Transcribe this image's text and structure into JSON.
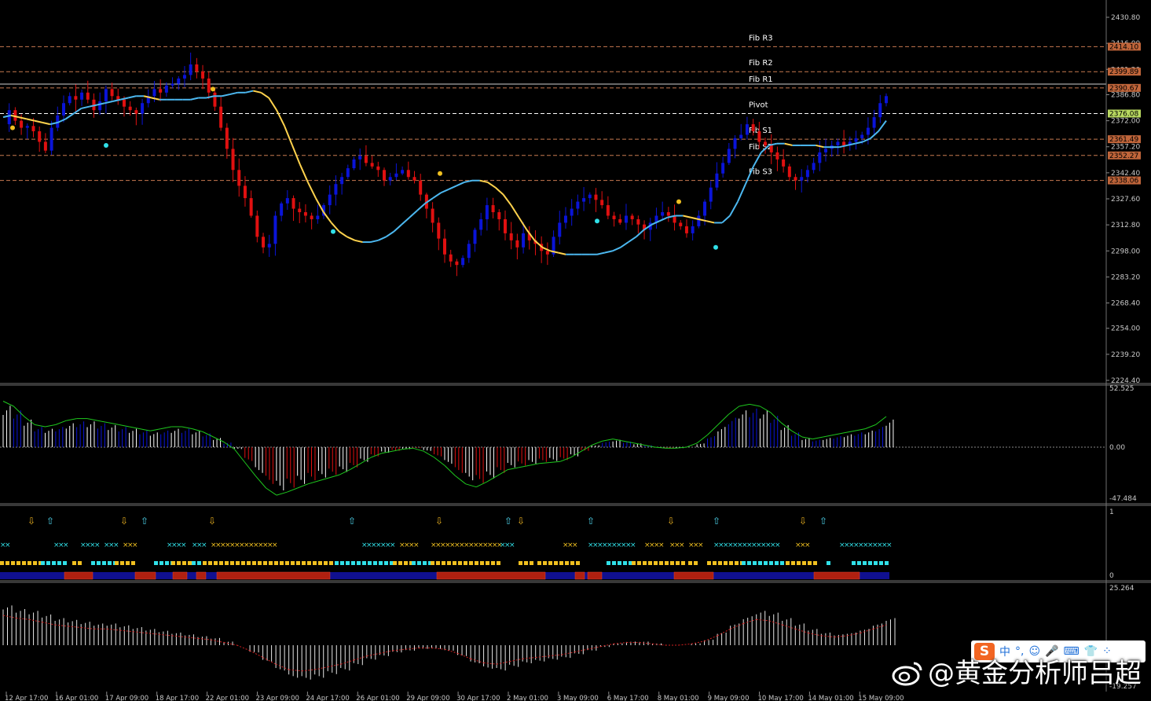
{
  "colors": {
    "bull": "#0a14d8",
    "bear": "#e01010",
    "ma_up": "#4cb8f0",
    "ma_down": "#ffd34d",
    "grid": "#555555",
    "fib_line": "#c87a50",
    "pivot_line": "#ffffff",
    "fib_label_bg": "#c0653a",
    "pivot_label_bg": "#b8d860",
    "osc_line": "#1ec81e",
    "osc2_line": "#d02020",
    "arrow_up": "#4cd0e8",
    "arrow_down": "#e8b020",
    "marker_cyan": "#30e0e8",
    "marker_yellow": "#f0c020",
    "band_blue": "#101090",
    "band_red": "#b02010"
  },
  "price_axis": {
    "ticks": [
      "2430.80",
      "2416.00",
      "2401.20",
      "2386.80",
      "2372.00",
      "2357.20",
      "2342.40",
      "2327.60",
      "2312.80",
      "2298.00",
      "2283.20",
      "2268.40",
      "2254.00",
      "2239.20",
      "2224.40"
    ],
    "min": 2224.4,
    "max": 2430.8
  },
  "levels": [
    {
      "name": "Fib R3",
      "value": 2414.1,
      "label": "2414.10",
      "kind": "fib"
    },
    {
      "name": "Fib R2",
      "value": 2399.89,
      "label": "2399.89",
      "kind": "fib"
    },
    {
      "name": "Fib R1",
      "value": 2390.67,
      "label": "2390.67",
      "kind": "fib"
    },
    {
      "name": "Pivot",
      "value": 2376.08,
      "label": "2376.08",
      "kind": "pivot"
    },
    {
      "name": "Fib S1",
      "value": 2361.49,
      "label": "2361.49",
      "kind": "fib"
    },
    {
      "name": "Fib S2",
      "value": 2352.27,
      "label": "2352.27",
      "kind": "fib"
    },
    {
      "name": "Fib S3",
      "value": 2338.06,
      "label": "2338.06",
      "kind": "fib"
    }
  ],
  "price_series": [
    2370,
    2378,
    2372,
    2368,
    2369,
    2366,
    2360,
    2355,
    2368,
    2375,
    2382,
    2386,
    2384,
    2388,
    2384,
    2378,
    2383,
    2390,
    2386,
    2384,
    2380,
    2378,
    2376,
    2382,
    2386,
    2390,
    2388,
    2392,
    2393,
    2396,
    2398,
    2404,
    2400,
    2396,
    2388,
    2380,
    2368,
    2356,
    2344,
    2335,
    2328,
    2318,
    2306,
    2300,
    2302,
    2318,
    2325,
    2328,
    2322,
    2320,
    2318,
    2316,
    2318,
    2324,
    2330,
    2336,
    2340,
    2345,
    2350,
    2352,
    2348,
    2346,
    2344,
    2338,
    2340,
    2342,
    2344,
    2340,
    2338,
    2330,
    2322,
    2314,
    2305,
    2296,
    2292,
    2290,
    2294,
    2302,
    2310,
    2316,
    2324,
    2320,
    2316,
    2308,
    2304,
    2300,
    2308,
    2304,
    2302,
    2298,
    2296,
    2306,
    2314,
    2318,
    2322,
    2326,
    2328,
    2330,
    2327,
    2324,
    2318,
    2316,
    2314,
    2318,
    2316,
    2313,
    2310,
    2314,
    2318,
    2320,
    2318,
    2314,
    2312,
    2308,
    2312,
    2318,
    2326,
    2334,
    2342,
    2348,
    2356,
    2362,
    2364,
    2370,
    2366,
    2360,
    2358,
    2354,
    2350,
    2346,
    2340,
    2338,
    2340,
    2344,
    2348,
    2354,
    2356,
    2358,
    2360,
    2358,
    2360,
    2362,
    2364,
    2368,
    2374,
    2382,
    2386
  ],
  "ma_series": [
    2374,
    2375,
    2374,
    2373,
    2372,
    2371,
    2370,
    2371,
    2373,
    2376,
    2379,
    2380,
    2381,
    2382,
    2383,
    2384,
    2385,
    2386,
    2386,
    2385,
    2384,
    2384,
    2384,
    2384,
    2384,
    2385,
    2385,
    2386,
    2386,
    2387,
    2388,
    2388,
    2389,
    2388,
    2385,
    2378,
    2369,
    2358,
    2347,
    2337,
    2328,
    2320,
    2314,
    2309,
    2306,
    2304,
    2303,
    2303,
    2304,
    2306,
    2309,
    2313,
    2317,
    2321,
    2325,
    2328,
    2331,
    2333,
    2335,
    2337,
    2338,
    2338,
    2337,
    2334,
    2330,
    2324,
    2317,
    2310,
    2304,
    2300,
    2298,
    2297,
    2296,
    2296,
    2296,
    2296,
    2296,
    2297,
    2298,
    2300,
    2303,
    2306,
    2310,
    2313,
    2315,
    2317,
    2318,
    2318,
    2317,
    2316,
    2315,
    2314,
    2314,
    2318,
    2326,
    2336,
    2346,
    2354,
    2358,
    2359,
    2359,
    2358,
    2358,
    2358,
    2358,
    2357,
    2357,
    2357,
    2358,
    2359,
    2360,
    2362,
    2366,
    2372
  ],
  "dates": [
    "12 Apr 17:00",
    "16 Apr 01:00",
    "17 Apr 09:00",
    "18 Apr 17:00",
    "22 Apr 01:00",
    "23 Apr 09:00",
    "24 Apr 17:00",
    "26 Apr 01:00",
    "29 Apr 09:00",
    "30 Apr 17:00",
    "2 May 01:00",
    "3 May 09:00",
    "6 May 17:00",
    "8 May 01:00",
    "9 May 09:00",
    "10 May 17:00",
    "14 May 01:00",
    "15 May 09:00"
  ],
  "osc1": {
    "top": "52.525",
    "zero": "0.00",
    "bottom": "-47.484",
    "values": [
      45,
      40,
      30,
      22,
      20,
      22,
      26,
      28,
      28,
      26,
      24,
      22,
      20,
      18,
      16,
      18,
      20,
      20,
      18,
      15,
      10,
      5,
      -2,
      -15,
      -28,
      -40,
      -47,
      -44,
      -40,
      -36,
      -33,
      -30,
      -27,
      -22,
      -16,
      -10,
      -6,
      -4,
      -2,
      -1,
      -4,
      -10,
      -18,
      -28,
      -36,
      -39,
      -34,
      -28,
      -22,
      -20,
      -18,
      -16,
      -15,
      -14,
      -10,
      -4,
      2,
      6,
      8,
      6,
      4,
      2,
      0,
      -1,
      -1,
      0,
      4,
      12,
      22,
      32,
      40,
      42,
      40,
      34,
      24,
      16,
      10,
      8,
      10,
      12,
      14,
      16,
      18,
      22,
      30
    ]
  },
  "osc2": {
    "top": "25.264",
    "bottom": "-19.257",
    "values": [
      22,
      20,
      19,
      17,
      15,
      14,
      13,
      12,
      12,
      11,
      10,
      9,
      8,
      7,
      6,
      5,
      4,
      2,
      0,
      -4,
      -9,
      -14,
      -18,
      -19,
      -18,
      -16,
      -14,
      -11,
      -8,
      -6,
      -4,
      -3,
      -2,
      -2,
      -3,
      -6,
      -10,
      -13,
      -14,
      -12,
      -10,
      -9,
      -8,
      -7,
      -5,
      -3,
      -1,
      1,
      2,
      2,
      1,
      0,
      0,
      1,
      3,
      7,
      12,
      16,
      19,
      18,
      15,
      12,
      9,
      7,
      6,
      7,
      9,
      12,
      15
    ]
  },
  "signals": {
    "up_arrow": "⇧",
    "down_arrow": "⇩",
    "cross": "×",
    "scale_top": "1",
    "scale_bottom": "0"
  },
  "watermark": {
    "text": "@黄金分析师吕超"
  },
  "ime": {
    "logo": "S",
    "items": [
      "中",
      "°,",
      "☺",
      "🎤",
      "⌨",
      "👕",
      "⁘"
    ]
  }
}
